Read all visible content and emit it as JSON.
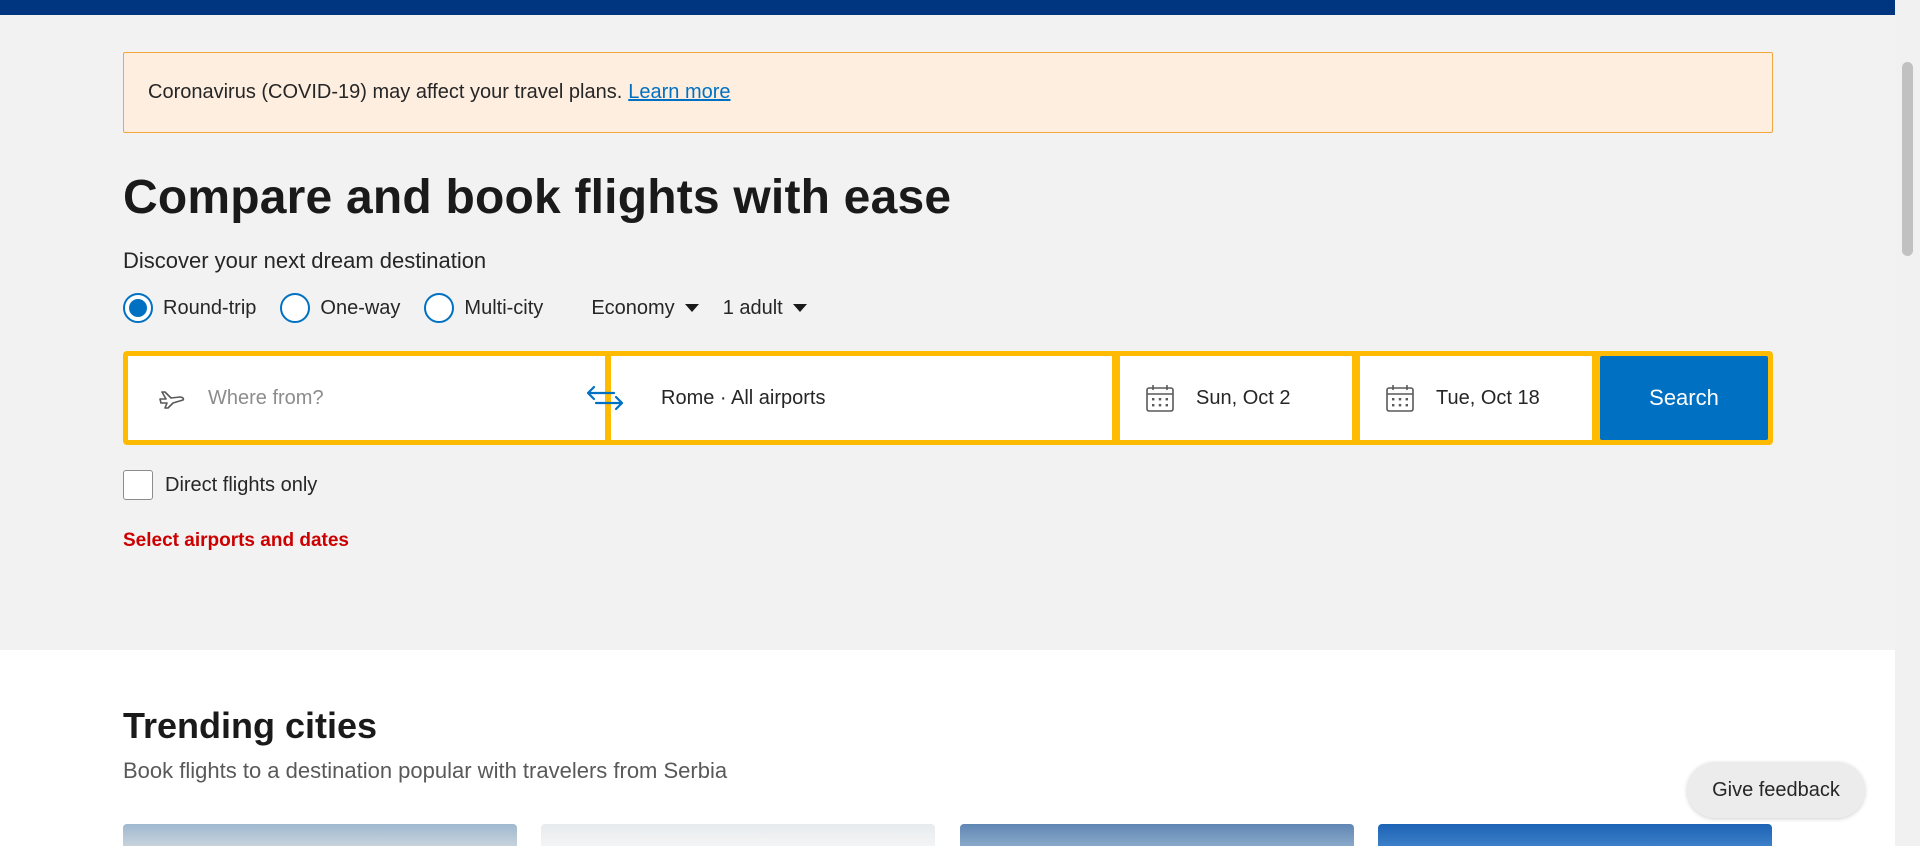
{
  "banner": {
    "text": "Coronavirus (COVID-19) may affect your travel plans.",
    "link": "Learn more"
  },
  "hero": {
    "title": "Compare and book flights with ease",
    "subtitle": "Discover your next dream destination"
  },
  "trip_options": {
    "round_trip": "Round-trip",
    "one_way": "One-way",
    "multi_city": "Multi-city",
    "selected": "Round-trip",
    "cabin_class": "Economy",
    "travelers": "1 adult"
  },
  "search": {
    "from_placeholder": "Where from?",
    "to_value": "Rome · All airports",
    "depart_date": "Sun, Oct 2",
    "return_date": "Tue, Oct 18",
    "button": "Search"
  },
  "filters": {
    "direct_only": "Direct flights only",
    "direct_checked": false
  },
  "validation": {
    "error": "Select airports and dates"
  },
  "trending": {
    "title": "Trending cities",
    "subtitle": "Book flights to a destination popular with travelers from Serbia"
  },
  "feedback": {
    "label": "Give feedback"
  },
  "colors": {
    "brand_navy": "#003580",
    "accent_blue": "#0071c2",
    "search_border": "#febb02",
    "error_red": "#cc0000",
    "banner_bg": "#fdeee0",
    "banner_border": "#f1a73e"
  },
  "icons": {
    "from_field": "plane-icon",
    "swap": "swap-arrows-icon",
    "dates": "calendar-icon",
    "dropdowns": "caret-down-icon"
  }
}
